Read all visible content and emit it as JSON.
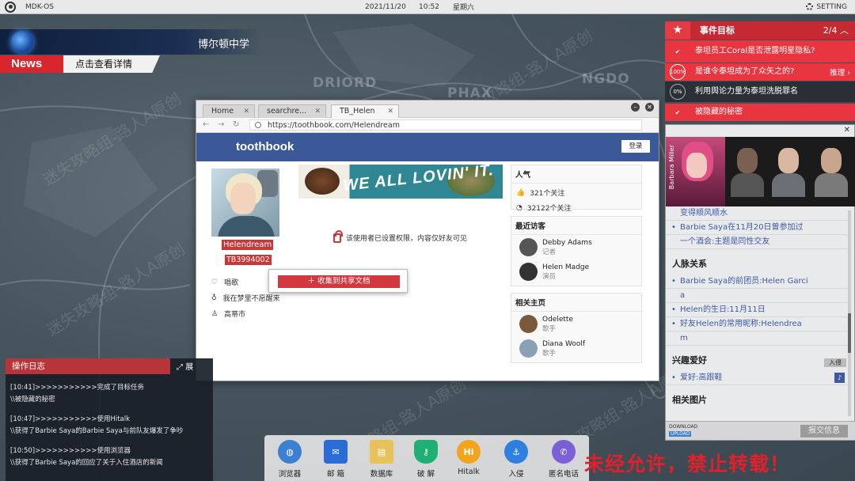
{
  "topbar": {
    "os": "MDK-OS",
    "date": "2021/11/20",
    "time": "10:52",
    "weekday": "星期六",
    "setting": "SETTING"
  },
  "news": {
    "headline": "博尔顿中学",
    "tag": "News",
    "detail": "点击查看详情"
  },
  "map_labels": [
    "DRIORD",
    "PHAX",
    "NGDO"
  ],
  "watermark": "迷失攻略组-路人A原创",
  "browser": {
    "tabs": [
      {
        "label": "Home"
      },
      {
        "label": "searchre..."
      },
      {
        "label": "TB_Helen"
      }
    ],
    "url": "https://toothbook.com/Helendream",
    "brand": "toothbook",
    "login": "登录",
    "profile": {
      "name": "Helendream",
      "id": "TB3994002"
    },
    "info": [
      "唱歌",
      "我在梦里不愿醒来",
      "高蒂市"
    ],
    "context_button": "收集到共享文档",
    "banner_text": "WE ALL LOVIN' IT.",
    "lock_message": "该使用者已设置权限，内容仅好友可见",
    "popularity": {
      "title": "人气",
      "likes": "321个关注",
      "followers": "32122个关注"
    },
    "visitors": {
      "title": "最近访客",
      "items": [
        {
          "name": "Debby Adams",
          "role": "记者"
        },
        {
          "name": "Helen Madge",
          "role": "演员"
        }
      ]
    },
    "related": {
      "title": "相关主页",
      "items": [
        {
          "name": "Odelette",
          "role": "歌手"
        },
        {
          "name": "Diana Woolf",
          "role": "歌手"
        }
      ]
    }
  },
  "mission": {
    "title": "事件目标",
    "progress": "2/4",
    "items": [
      {
        "text": "泰坦员工Coral是否泄露明星隐私?",
        "status": "done"
      },
      {
        "text": "是谁令泰坦成为了众矢之的?",
        "status": "100%",
        "extra": "推理"
      },
      {
        "text": "利用舆论力量为泰坦洗脱罪名",
        "status": "0%"
      },
      {
        "text": "被隐藏的秘密",
        "status": "done"
      }
    ]
  },
  "character": {
    "name_tag": "Barbara Miller",
    "lines": [
      {
        "text": "变得顺风顺水",
        "bullet": false
      },
      {
        "text": "Barbie Saya在11月20日曾参加过",
        "bullet": true
      },
      {
        "text": "一个酒会:主题是同性交友",
        "bullet": false
      }
    ],
    "section1": "人脉关系",
    "lines2": [
      {
        "text": "Barbie Saya的前团员:Helen Garci",
        "bullet": true
      },
      {
        "text": "a",
        "bullet": false
      },
      {
        "text": "Helen的生日:11月11日",
        "bullet": true
      },
      {
        "text": "好友Helen的常用昵称:Helendrea",
        "bullet": true
      },
      {
        "text": "m",
        "bullet": false
      }
    ],
    "section2": "兴趣爱好",
    "hobby": "爱好:高跟鞋",
    "tag": "入侵",
    "section3": "相关图片",
    "download": "DOWNLOAD",
    "upload": "UPLOAD",
    "submit": "报交信息"
  },
  "log": {
    "title": "操作日志",
    "expand": "展",
    "entries": [
      "[10:41]>>>>>>>>>>>完成了目标任务",
      "\\\\被隐藏的秘密",
      "[10:47]>>>>>>>>>>>使用Hitalk",
      "\\\\获得了Barbie Saya的Barbie Saya与前队友爆发了争吵",
      "[10:50]>>>>>>>>>>>使用浏览器",
      "\\\\获得了Barbie Saya的回应了关于入住酒店的新闻"
    ]
  },
  "dock": [
    {
      "label": "浏览器",
      "icon": "globe-icon",
      "color": "#3d7fd1"
    },
    {
      "label": "邮 箱",
      "icon": "mail-icon",
      "color": "#2b6bd6"
    },
    {
      "label": "数据库",
      "icon": "database-icon",
      "color": "#e7c25a"
    },
    {
      "label": "破 解",
      "icon": "shield-icon",
      "color": "#1fae73"
    },
    {
      "label": "Hitalk",
      "icon": "hitalk-icon",
      "color": "#f2a51c"
    },
    {
      "label": "入侵",
      "icon": "hook-icon",
      "color": "#2f7fe0"
    },
    {
      "label": "匿名电话",
      "icon": "phone-icon",
      "color": "#7a5fd6"
    }
  ],
  "copyright": "未经允许，禁止转载！"
}
